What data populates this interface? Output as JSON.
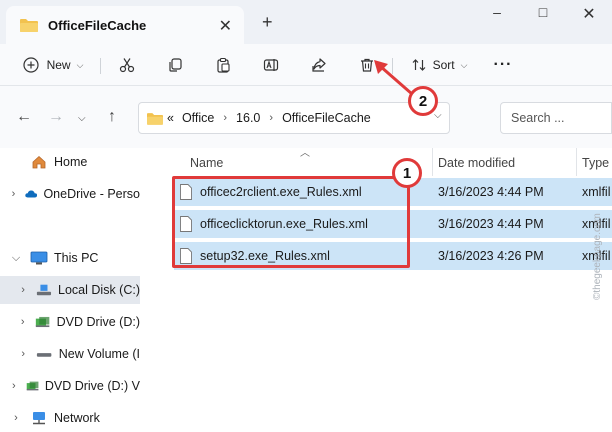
{
  "window": {
    "tab_title": "OfficeFileCache",
    "new_tab": "+",
    "controls": {
      "minimize": "–",
      "maximize": "□",
      "close": "✕"
    }
  },
  "toolbar": {
    "new_label": "New",
    "sort_label": "Sort",
    "more": "···",
    "icons": [
      "cut-icon",
      "copy-icon",
      "paste-icon",
      "rename-icon",
      "share-icon",
      "delete-icon"
    ]
  },
  "address": {
    "overflow": "«",
    "path": [
      "Office",
      "16.0",
      "OfficeFileCache"
    ],
    "search_placeholder": "Search ..."
  },
  "sidebar": {
    "items": [
      {
        "label": "Home",
        "icon": "home-icon"
      },
      {
        "label": "OneDrive - Perso",
        "icon": "cloud-icon"
      },
      {
        "label": "This PC",
        "icon": "monitor-icon"
      },
      {
        "label": "Local Disk (C:)",
        "icon": "drive-icon"
      },
      {
        "label": "DVD Drive (D:)",
        "icon": "dvd-icon"
      },
      {
        "label": "New Volume (I",
        "icon": "drive-icon"
      },
      {
        "label": "DVD Drive (D:) V",
        "icon": "dvd-icon"
      },
      {
        "label": "Network",
        "icon": "network-icon"
      }
    ]
  },
  "columns": {
    "name": "Name",
    "date": "Date modified",
    "type": "Type"
  },
  "files": [
    {
      "name": "officec2rclient.exe_Rules.xml",
      "date": "3/16/2023 4:44 PM",
      "type": "xmlfil"
    },
    {
      "name": "officeclicktorun.exe_Rules.xml",
      "date": "3/16/2023 4:44 PM",
      "type": "xmlfil"
    },
    {
      "name": "setup32.exe_Rules.xml",
      "date": "3/16/2023 4:26 PM",
      "type": "xmlfil"
    }
  ],
  "annotations": {
    "badge_1": "1",
    "badge_2": "2",
    "color": "#e03a3a"
  },
  "watermark": "©thegeekpage.com",
  "colors": {
    "selection": "#cce4f7",
    "folder": "#f2c24f",
    "accent": "#0067c0"
  }
}
